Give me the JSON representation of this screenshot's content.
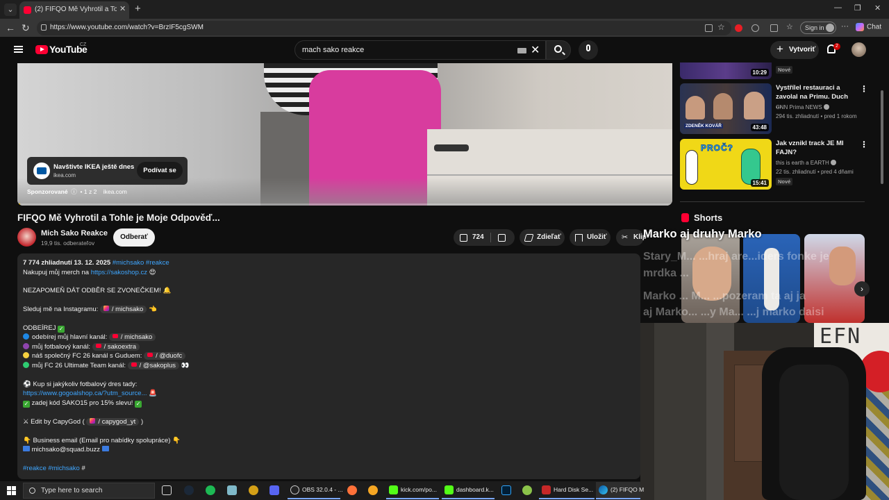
{
  "browser": {
    "tab_title": "(2) FIFQO Mě Vyhrotil a Tohle je Mo",
    "url": "https://www.youtube.com/watch?v=BrzIF5cgSWM",
    "signin_label": "Sign in",
    "chat_label": "Chat",
    "accent": "#ff0033"
  },
  "yt_header": {
    "logo_text": "YouTube",
    "region": "CZ",
    "search_query": "mach sako reakce",
    "create_label": "Vytvoriť",
    "notif_count": "2"
  },
  "video": {
    "title": "FIFQO Mě Vyhrotil a Tohle je Moje Odpověď...",
    "progress_fraction": 0.004,
    "ad": {
      "headline": "Navštivte IKEA ještě dnes",
      "domain": "ikea.com",
      "cta": "Podívat se",
      "sponsored_label": "Sponzorované",
      "count": "• 1 z 2",
      "sponsor_domain": "ikea.com"
    }
  },
  "channel": {
    "name": "Mich Sako Reakce",
    "subs": "19,9 tis. odberateľov",
    "subscribe_label": "Odberať"
  },
  "actions": {
    "likes": "724",
    "share": "Zdieľať",
    "save": "Uložiť",
    "clip": "Klip"
  },
  "description": {
    "stats": "7 774 zhliadnutí  13. 12. 2025",
    "stats_tags": "#michsako #reakce",
    "merch_prefix": "Nakupuj můj merch na",
    "merch_link": "https://sakoshop.cz",
    "merch_emoji": "😍",
    "reminder": "NEZAPOMEŇ DÁT ODBĚR SE ZVONEČKEM! 🔔",
    "insta_prefix": "Sleduj mě na Instagramu:",
    "insta_chip": "/ michsako",
    "insta_emoji": "👈",
    "subscribe_head": "ODBEÍREJ",
    "ch1_label": "odebírej můj hlavní kanál:",
    "ch1_chip": "/ michsako",
    "ch2_label": "můj fotbalový kanál:",
    "ch2_chip": "/ sakoextra",
    "ch3_label": "náš společný FC 26 kanál s Guduem:",
    "ch3_chip": "/ @duofc",
    "ch4_label": "můj FC 26 Ultimate Team kanál:",
    "ch4_chip": "/ @sakoplus",
    "ch4_emoji": "👀",
    "jersey": "⚽ Kup si jakýkoliv fotbalový dres tady:",
    "jersey_link": "https://www.gogoalshop.ca/?utm_source...",
    "jersey_emoji": "🚨",
    "code": "zadej kód SAKO15 pro 15% slevu!",
    "edit_prefix": "⚔ Edit by CapyGod (",
    "edit_chip": "/ capygod_yt",
    "edit_suffix": ")",
    "business": "👇 Business email (Email pro nabídky spolupráce) 👇",
    "email": "michsako@squad.buzz",
    "tags": "#reakce #michsako",
    "tags_end": "#",
    "dot_colors": [
      "#1e88e5",
      "#8e44ad",
      "#f4d03f",
      "#2ecc71"
    ]
  },
  "recommended": [
    {
      "duration": "10:29",
      "badge": "Nové"
    },
    {
      "title": "Vystřílel restauraci a zavolal na Primu. Duch ...",
      "channel": "CNN Prima NEWS",
      "meta": "294 tis. zhliadnutí • pred 1 rokom",
      "duration": "43:48",
      "thumb_text": "ZDENĚK KOVÁŘ"
    },
    {
      "title": "Jak vznikl track JE MI FAJN?",
      "channel": "this is earth a EARTH",
      "meta": "22 tis. zhliadnutí • pred 4 dňami",
      "duration": "15:41",
      "badge": "Nové",
      "thumb_text": "PROČ?"
    }
  ],
  "shorts": {
    "heading": "Shorts"
  },
  "overlay": {
    "line1": "Marko aj druhy Marko",
    "line2": "Stary_M... ...hraj are...iders fonke je",
    "line3": "mrdka ...",
    "line4": "Marko ... M... ...pozeram ta aj ja",
    "line5": "aj Marko... ...y Ma... ...j marko daisi"
  },
  "webcam": {
    "board_text": "EFN"
  },
  "taskbar": {
    "search_placeholder": "Type here to search",
    "apps": [
      "OBS 32.0.4 - ...",
      "kick.com/po...",
      "dashboard.k...",
      "Hard Disk Se...",
      "(2) FIFQO M"
    ]
  }
}
